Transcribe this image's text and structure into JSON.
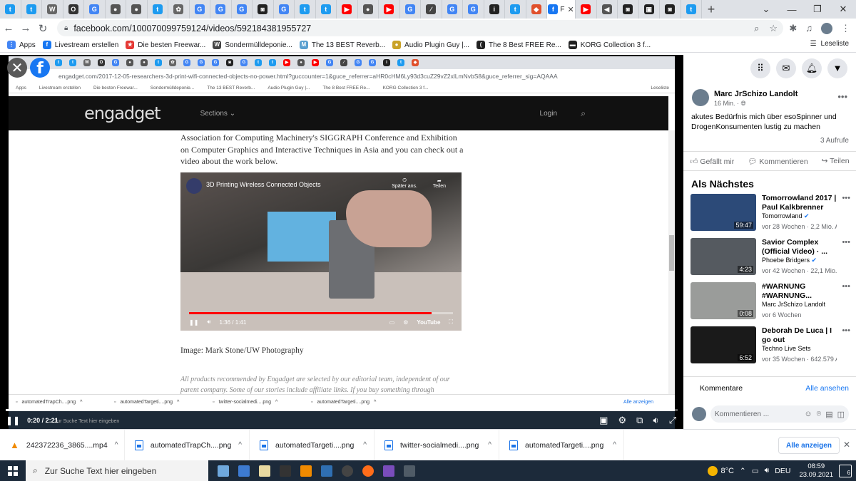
{
  "browser_tabs": [
    {
      "icon": "twitter-icon",
      "color": "#1d9bf0",
      "glyph": "t"
    },
    {
      "icon": "twitter-icon",
      "color": "#1d9bf0",
      "glyph": "t"
    },
    {
      "icon": "wikipedia-icon",
      "color": "#666",
      "glyph": "W"
    },
    {
      "icon": "github-icon",
      "color": "#333",
      "glyph": "O"
    },
    {
      "icon": "google-translate-icon",
      "color": "#4285f4",
      "glyph": "G"
    },
    {
      "icon": "web-icon",
      "color": "#555",
      "glyph": "●"
    },
    {
      "icon": "web-icon",
      "color": "#555",
      "glyph": "●"
    },
    {
      "icon": "twitter-icon",
      "color": "#1d9bf0",
      "glyph": "t"
    },
    {
      "icon": "settings-icon",
      "color": "#666",
      "glyph": "✿"
    },
    {
      "icon": "google-icon",
      "color": "#4285f4",
      "glyph": "G"
    },
    {
      "icon": "google-icon",
      "color": "#4285f4",
      "glyph": "G"
    },
    {
      "icon": "google-icon",
      "color": "#4285f4",
      "glyph": "G"
    },
    {
      "icon": "app-icon",
      "color": "#222",
      "glyph": "◙"
    },
    {
      "icon": "google-icon",
      "color": "#4285f4",
      "glyph": "G"
    },
    {
      "icon": "twitter-icon",
      "color": "#1d9bf0",
      "glyph": "t"
    },
    {
      "icon": "twitter-icon",
      "color": "#1d9bf0",
      "glyph": "t"
    },
    {
      "icon": "youtube-icon",
      "color": "#f00",
      "glyph": "▶"
    },
    {
      "icon": "web-icon",
      "color": "#555",
      "glyph": "●"
    },
    {
      "icon": "youtube-icon",
      "color": "#f00",
      "glyph": "▶"
    },
    {
      "icon": "google-icon",
      "color": "#4285f4",
      "glyph": "G"
    },
    {
      "icon": "signature-icon",
      "color": "#444",
      "glyph": "∕"
    },
    {
      "icon": "google-icon",
      "color": "#4285f4",
      "glyph": "G"
    },
    {
      "icon": "google-icon",
      "color": "#4285f4",
      "glyph": "G"
    },
    {
      "icon": "info-icon",
      "color": "#222",
      "glyph": "i"
    },
    {
      "icon": "twitter-icon",
      "color": "#1d9bf0",
      "glyph": "t"
    },
    {
      "icon": "brave-icon",
      "color": "#e0502c",
      "glyph": "◆"
    }
  ],
  "active_tab": {
    "icon": "facebook-icon",
    "color": "#1877f2",
    "glyph": "f",
    "label": "F"
  },
  "browser_tabs_after": [
    {
      "icon": "youtube-icon",
      "color": "#f00",
      "glyph": "▶"
    },
    {
      "icon": "audio-tab-icon",
      "color": "#555",
      "glyph": "◀"
    },
    {
      "icon": "app-icon",
      "color": "#222",
      "glyph": "◙"
    },
    {
      "icon": "app-icon",
      "color": "#222",
      "glyph": "▣"
    },
    {
      "icon": "app-icon",
      "color": "#222",
      "glyph": "◙"
    },
    {
      "icon": "twitter-icon",
      "color": "#1d9bf0",
      "glyph": "t"
    }
  ],
  "address": {
    "url": "facebook.com/100070099759124/videos/592184381955727"
  },
  "bookmarks": [
    {
      "label": "Apps",
      "icon": "apps-grid-icon",
      "color": "#4285f4",
      "glyph": "⋮"
    },
    {
      "label": "Livestream erstellen",
      "icon": "facebook-icon",
      "color": "#1877f2",
      "glyph": "f"
    },
    {
      "label": "Die besten Freewar...",
      "icon": "star-icon",
      "color": "#e53935",
      "glyph": "★"
    },
    {
      "label": "Sondermülldeponie...",
      "icon": "wikipedia-icon",
      "color": "#444",
      "glyph": "W"
    },
    {
      "label": "The 13 BEST Reverb...",
      "icon": "bookmark-logo-icon",
      "color": "#5aa0d0",
      "glyph": "M"
    },
    {
      "label": "Audio Plugin Guy |...",
      "icon": "bookmark-logo-icon",
      "color": "#c9a227",
      "glyph": "●"
    },
    {
      "label": "The 8 Best FREE Re...",
      "icon": "bookmark-logo-icon",
      "color": "#222",
      "glyph": "("
    },
    {
      "label": "KORG Collection 3 f...",
      "icon": "korg-icon",
      "color": "#222",
      "glyph": "▬"
    }
  ],
  "reading_list": "Leseliste",
  "inner_screen": {
    "url": "engadget.com/2017-12-05-researchers-3d-print-wifi-connected-objects-no-power.html?guccounter=1&guce_referrer=aHR0cHM6Ly93d3cuZ29vZ2xlLmNvbS8&guce_referrer_sig=AQAAAMiC6fxCV6raSFtX...",
    "bookmarks": [
      "Apps",
      "Livestream erstellen",
      "Die besten Freewar...",
      "Sondermülldeponie...",
      "The 13 BEST Reverb...",
      "Audio Plugin Guy |...",
      "The 8 Best FREE Re...",
      "KORG Collection 3 f..."
    ],
    "reading_list": "Leseliste",
    "site_logo": "engadget",
    "sections": "Sections",
    "login": "Login",
    "article_text": "Association for Computing Machinery's SIGGRAPH Conference and Exhibition on Computer Graphics and Interactive Techniques in Asia and you can check out a video about the work below.",
    "video_title": "3D Printing Wireless Connected Objects",
    "video_watch_later": "Später ans.",
    "video_share": "Teilen",
    "video_time": "1:36 / 1:41",
    "video_brand": "YouTube",
    "image_caption": "Image: Mark Stone/UW Photography",
    "disclaimer": "All products recommended by Engadget are selected by our editorial team, independent of our parent company. Some of our stories include affiliate links. If you buy something through",
    "downloads": [
      "automatedTrapCh....png",
      "automatedTargeti....png",
      "twitter-socialmedi....png",
      "automatedTargeti....png"
    ],
    "downloads_all": "Alle anzeigen",
    "taskbar_search": "Zur Suche Text hier eingeben"
  },
  "player": {
    "time": "0:20 / 2:21",
    "progress": 0.14
  },
  "fb_header_icons": [
    "menu-grid-icon",
    "messenger-icon",
    "notifications-icon",
    "account-dropdown-icon"
  ],
  "post": {
    "author": "Marc JrSchizo Landolt",
    "time": "16 Min. · ",
    "text": "akutes Bedürfnis mich über esoSpinner und DrogenKonsumenten lustig zu machen",
    "views": "3 Aufrufe",
    "like": "Gefällt mir",
    "comment": "Kommentieren",
    "share": "Teilen"
  },
  "up_next": {
    "heading": "Als Nächstes",
    "videos": [
      {
        "title": "Tomorrowland 2017 | Paul Kalkbrenner",
        "channel": "Tomorrowland",
        "verified": true,
        "meta": "vor 28 Wochen · 2,2 Mio. Au",
        "duration": "59:47",
        "thumb": "#2c4a78"
      },
      {
        "title": "Savior Complex (Official Video) · ...",
        "channel": "Phoebe Bridgers",
        "verified": true,
        "meta": "vor 42 Wochen · 22,1 Mio. A",
        "duration": "4:23",
        "thumb": "#555a60"
      },
      {
        "title": "#WARNUNG #WARNUNG...",
        "channel": "Marc JrSchizo Landolt",
        "verified": false,
        "meta": "vor 6 Wochen",
        "duration": "0:08",
        "thumb": "#9a9c9a"
      },
      {
        "title": "Deborah De Luca | I go out",
        "channel": "Techno Live Sets",
        "verified": false,
        "meta": "vor 35 Wochen · 642.579 Au",
        "duration": "6:52",
        "thumb": "#1a1a1a"
      }
    ]
  },
  "comments": {
    "heading": "Kommentare",
    "see_all": "Alle ansehen",
    "placeholder": "Kommentieren ..."
  },
  "downloads": [
    {
      "name": "242372236_3865....mp4",
      "type": "vlc"
    },
    {
      "name": "automatedTrapCh....png",
      "type": "png"
    },
    {
      "name": "automatedTargeti....png",
      "type": "png"
    },
    {
      "name": "twitter-socialmedi....png",
      "type": "png"
    },
    {
      "name": "automatedTargeti....png",
      "type": "png"
    }
  ],
  "downloads_all": "Alle anzeigen",
  "taskbar": {
    "search_placeholder": "Zur Suche Text hier eingeben",
    "apps": [
      {
        "icon": "notepad-icon",
        "color": "#6fa8dc"
      },
      {
        "icon": "sync-app-icon",
        "color": "#3d7bd1"
      },
      {
        "icon": "pen-app-icon",
        "color": "#e8d9a0"
      },
      {
        "icon": "terminal-icon",
        "color": "#333"
      },
      {
        "icon": "vlc-icon",
        "color": "#f08a00"
      },
      {
        "icon": "photos-icon",
        "color": "#2f6fb2"
      },
      {
        "icon": "obs-icon",
        "color": "#444"
      },
      {
        "icon": "firefox-icon",
        "color": "#ff6d1a"
      },
      {
        "icon": "tor-icon",
        "color": "#7a4dbb"
      },
      {
        "icon": "calculator-icon",
        "color": "#4f5b66"
      }
    ],
    "temperature": "8°C",
    "language": "DEU",
    "time": "08:59",
    "date": "23.09.2021",
    "notifications": "6"
  }
}
